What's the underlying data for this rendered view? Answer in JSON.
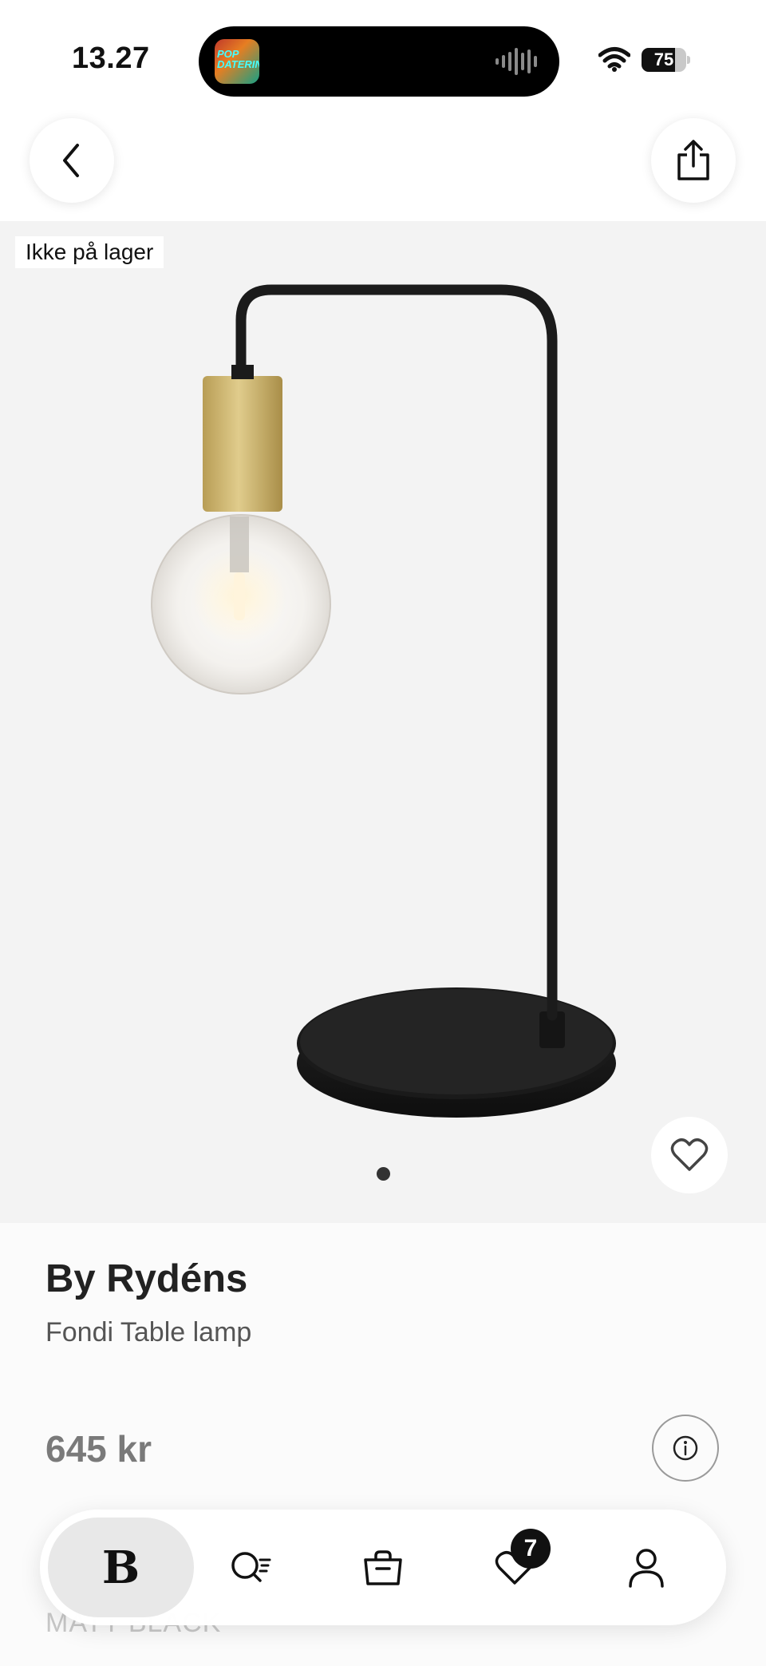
{
  "status_bar": {
    "time": "13.27",
    "now_playing_art_text": "POP DATERIN",
    "battery_level": "75"
  },
  "header": {
    "back_icon": "chevron-left-icon",
    "share_icon": "share-icon"
  },
  "gallery": {
    "stock_badge": "Ikke på lager",
    "image_count": 1,
    "active_index": 0,
    "favorite_icon": "heart-icon"
  },
  "product": {
    "brand": "By Rydéns",
    "name": "Fondi Table lamp",
    "price": "645 kr",
    "info_icon": "info-icon",
    "color_label": "MATT BLACK"
  },
  "bottom_nav": {
    "home_logo": "B",
    "search_icon": "search-icon",
    "bag_icon": "bag-icon",
    "wishlist_icon": "heart-icon",
    "wishlist_count": "7",
    "profile_icon": "person-icon"
  },
  "colors": {
    "accent": "#111111",
    "gallery_bg": "#f3f3f3",
    "page_bg": "#fbfbfb",
    "lamp_brass": "#c9b06a"
  }
}
